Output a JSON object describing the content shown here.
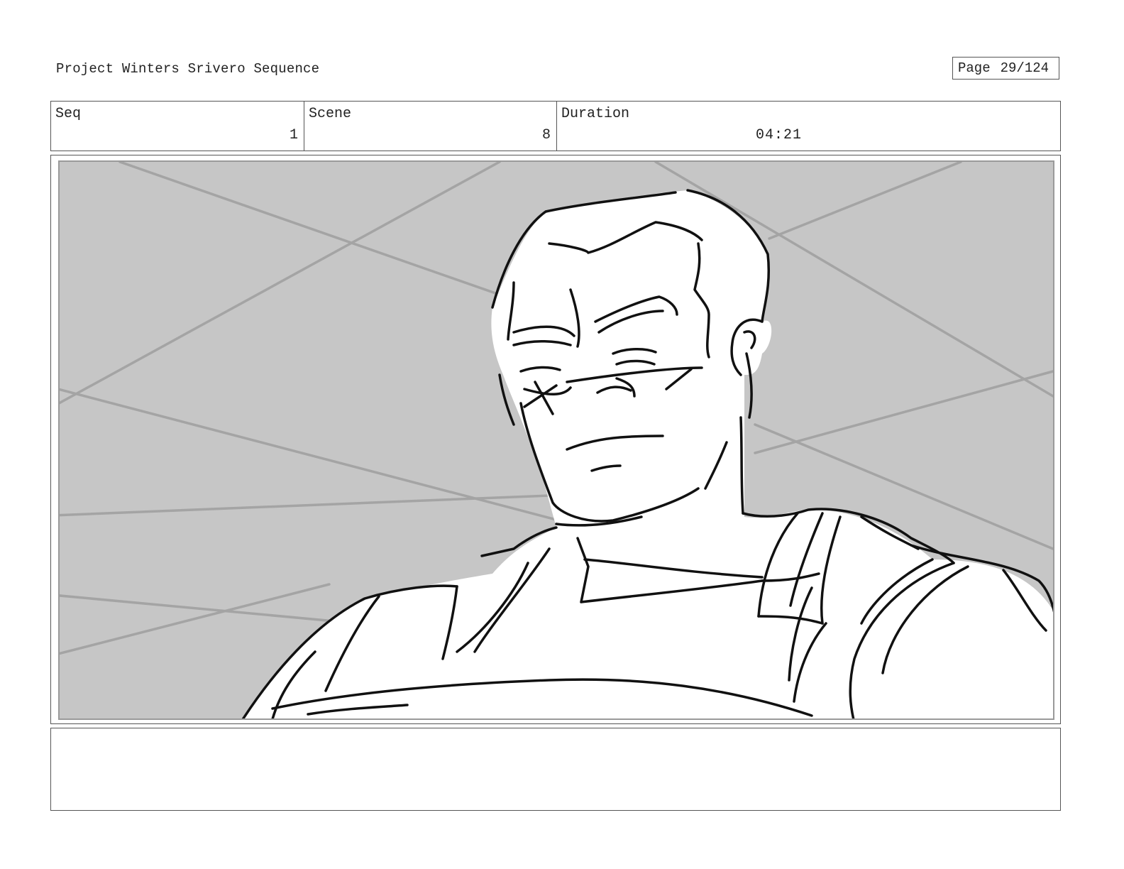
{
  "header": {
    "project_title": "Project Winters Srivero Sequence",
    "page_label": "Page",
    "page_number": "29/124"
  },
  "meta": {
    "seq_label": "Seq",
    "seq_value": "1",
    "scene_label": "Scene",
    "scene_value": "8",
    "duration_label": "Duration",
    "duration_value": "04:21"
  },
  "panel": {
    "description": "Storyboard sketch: low-angle close-up of a man in a tactical vest with a scarred face, against a grey background with crossing lines",
    "background_color": "#c6c6c6",
    "line_color": "#111111"
  },
  "notes": {
    "text": ""
  }
}
